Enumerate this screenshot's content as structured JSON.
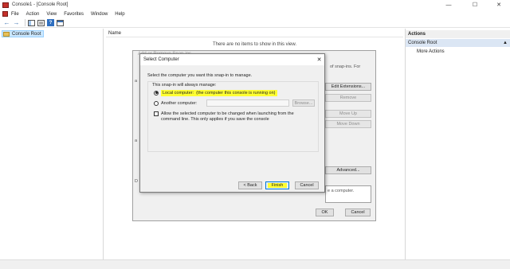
{
  "window": {
    "title": "Console1 - [Console Root]",
    "minimize_glyph": "—",
    "maximize_glyph": "☐",
    "close_glyph": "✕"
  },
  "menubar": {
    "items": [
      "File",
      "Action",
      "View",
      "Favorites",
      "Window",
      "Help"
    ]
  },
  "toolbar": {
    "back_glyph": "←",
    "forward_glyph": "→",
    "help_glyph": "?"
  },
  "tree": {
    "root_label": "Console Root"
  },
  "results": {
    "column_name": "Name",
    "empty_message": "There are no items to show in this view."
  },
  "actions": {
    "title": "Actions",
    "section_label": "Console Root",
    "more_actions": "More Actions",
    "section_arrow": "▲",
    "more_arrow": "▶"
  },
  "snapin_dialog": {
    "title_fragment": "Add or Remove Snap-ins",
    "text_right_top": "of snap-ins. For",
    "text_right_desc": "e a computer.",
    "edit_extensions_button": "Edit Extensions...",
    "remove_button": "Remove",
    "move_up_button": "Move Up",
    "move_down_button": "Move Down",
    "advanced_button": "Advanced...",
    "ok_button": "OK",
    "cancel_button": "Cancel"
  },
  "select_computer": {
    "title": "Select Computer",
    "close_glyph": "✕",
    "instruction": "Select the computer you want this snap-in to manage.",
    "group_label": "This snap-in will always manage:",
    "local_label": "Local computer:",
    "local_note": "(the computer this console is running on)",
    "local_selected": true,
    "another_label": "Another computer:",
    "computer_value": "",
    "browse_button": "Browse...",
    "allow_change_text": "Allow the selected computer to be changed when launching from the command line.  This only applies if you save the console",
    "allow_change_checked": false,
    "back_button": "< Back",
    "finish_button": "Finish",
    "cancel_button": "Cancel",
    "highlight_color": "#ffff32"
  }
}
